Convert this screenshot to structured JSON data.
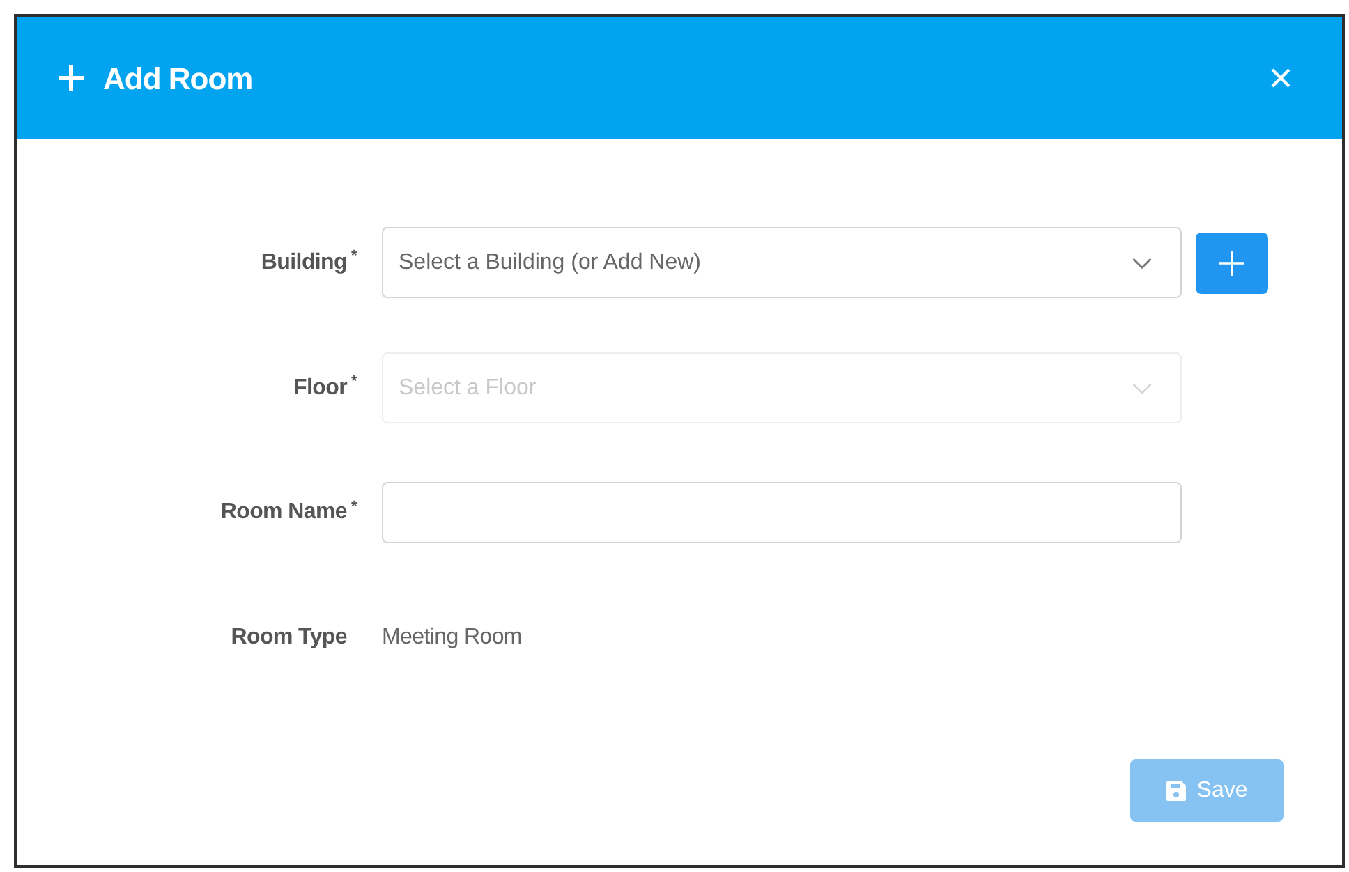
{
  "dialog": {
    "title": "Add Room"
  },
  "fields": [
    {
      "kind": "select",
      "label": "Building",
      "required_mark": "*",
      "placeholder": "Select a Building (or Add New)",
      "disabled": false,
      "add_button": true
    },
    {
      "kind": "select",
      "label": "Floor",
      "required_mark": "*",
      "placeholder": "Select a Floor",
      "disabled": true
    },
    {
      "kind": "text",
      "label": "Room Name",
      "required_mark": "*",
      "disabled": false
    },
    {
      "kind": "static",
      "label": "Room Type",
      "value": "Meeting Room"
    }
  ],
  "save_button": {
    "label": "Save",
    "disabled": true
  }
}
